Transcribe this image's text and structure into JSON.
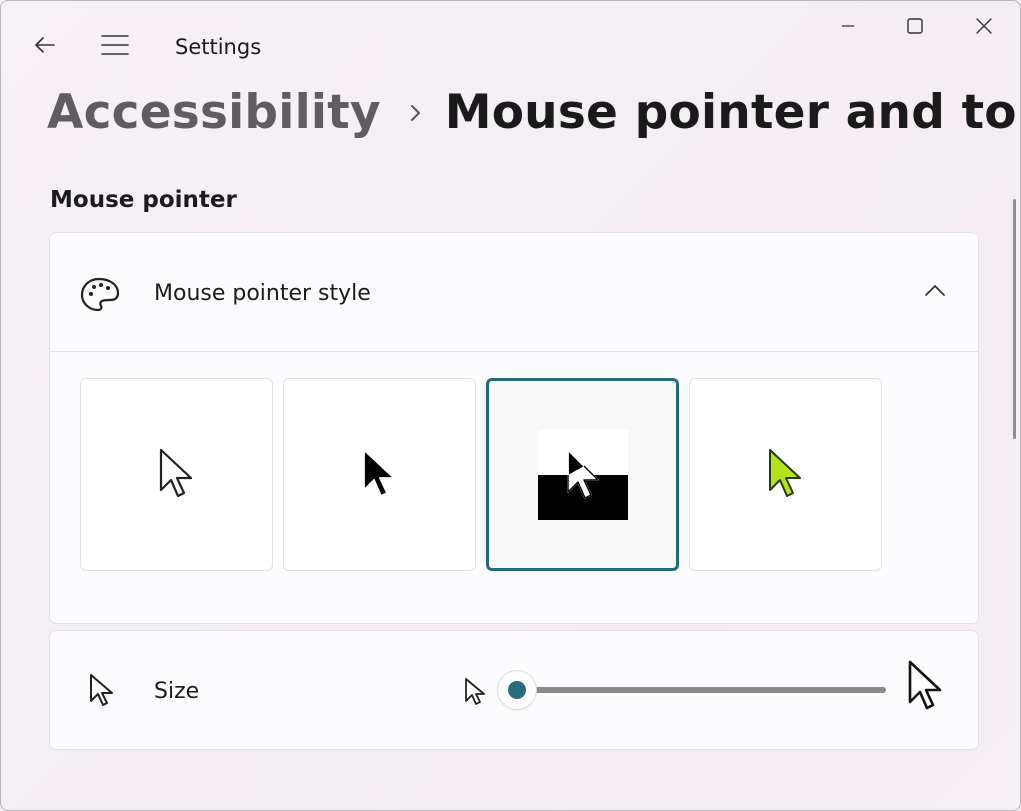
{
  "window": {
    "app_title": "Settings",
    "controls": [
      "minimize-icon",
      "maximize-icon",
      "close-icon"
    ]
  },
  "nav": {
    "icons": [
      "back-arrow-icon",
      "hamburger-menu-icon"
    ]
  },
  "breadcrumb": {
    "parent": "Accessibility",
    "separator_icon": "chevron-right-icon",
    "current": "Mouse pointer and touch"
  },
  "mouse_pointer": {
    "section_title": "Mouse pointer",
    "style": {
      "label": "Mouse pointer style",
      "icon": "palette-icon",
      "expanded": true,
      "options": [
        {
          "name": "white",
          "selected": false
        },
        {
          "name": "black",
          "selected": false
        },
        {
          "name": "inverted",
          "selected": true
        },
        {
          "name": "custom",
          "selected": false,
          "color": "#b4e31e"
        }
      ]
    },
    "size": {
      "label": "Size",
      "icon": "cursor-icon",
      "value": 1,
      "min": 1,
      "max": 15
    }
  },
  "colors": {
    "accent": "#2b6b7b",
    "custom_pointer": "#b4e31e"
  }
}
